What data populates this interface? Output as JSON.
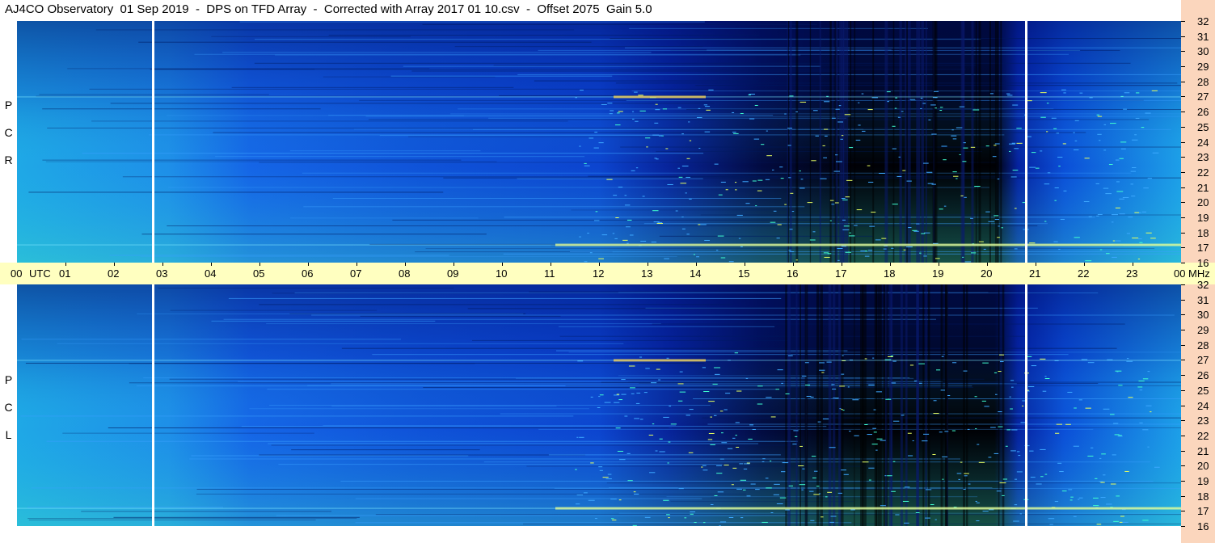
{
  "title": "AJ4CO Observatory  01 Sep 2019  -  DPS on TFD Array  -  Corrected with Array 2017 01 10.csv  -  Offset 2075  Gain 5.0",
  "panels": [
    {
      "id": "rcp",
      "side_label": [
        "R",
        "C",
        "P"
      ]
    },
    {
      "id": "lcp",
      "side_label": [
        "L",
        "C",
        "P"
      ]
    }
  ],
  "time_axis": {
    "start_label": "00",
    "unit_label": "UTC",
    "ticks": [
      "01",
      "02",
      "03",
      "04",
      "05",
      "06",
      "07",
      "08",
      "09",
      "10",
      "11",
      "12",
      "13",
      "14",
      "15",
      "16",
      "17",
      "18",
      "19",
      "20",
      "21",
      "22",
      "23"
    ],
    "end_label": "00",
    "freq_unit": "MHz"
  },
  "freq_axis": {
    "ticks": [
      "32",
      "31",
      "30",
      "29",
      "28",
      "27",
      "26",
      "25",
      "24",
      "23",
      "22",
      "21",
      "20",
      "19",
      "18",
      "17",
      "16"
    ]
  },
  "colors": {
    "background_band": "#ffffc0",
    "freq_axis_bg": "#fbd6bd",
    "low_intensity": "#000000",
    "mid_intensity": "#0a3fd6",
    "high_intensity": "#2fe0d0"
  },
  "chart_data": {
    "type": "heatmap",
    "title": "AJ4CO Observatory  01 Sep 2019  -  DPS on TFD Array  -  Corrected with Array 2017 01 10.csv  -  Offset 2075  Gain 5.0",
    "x_unit": "UTC hours",
    "xlim": [
      0,
      24
    ],
    "y_unit": "MHz",
    "ylim": [
      16,
      32
    ],
    "gaps_hours": [
      2.8,
      20.8
    ],
    "strong_lines_mhz": [
      27.0,
      17.2
    ],
    "dark_region_hours": [
      13.5,
      20.5
    ]
  }
}
